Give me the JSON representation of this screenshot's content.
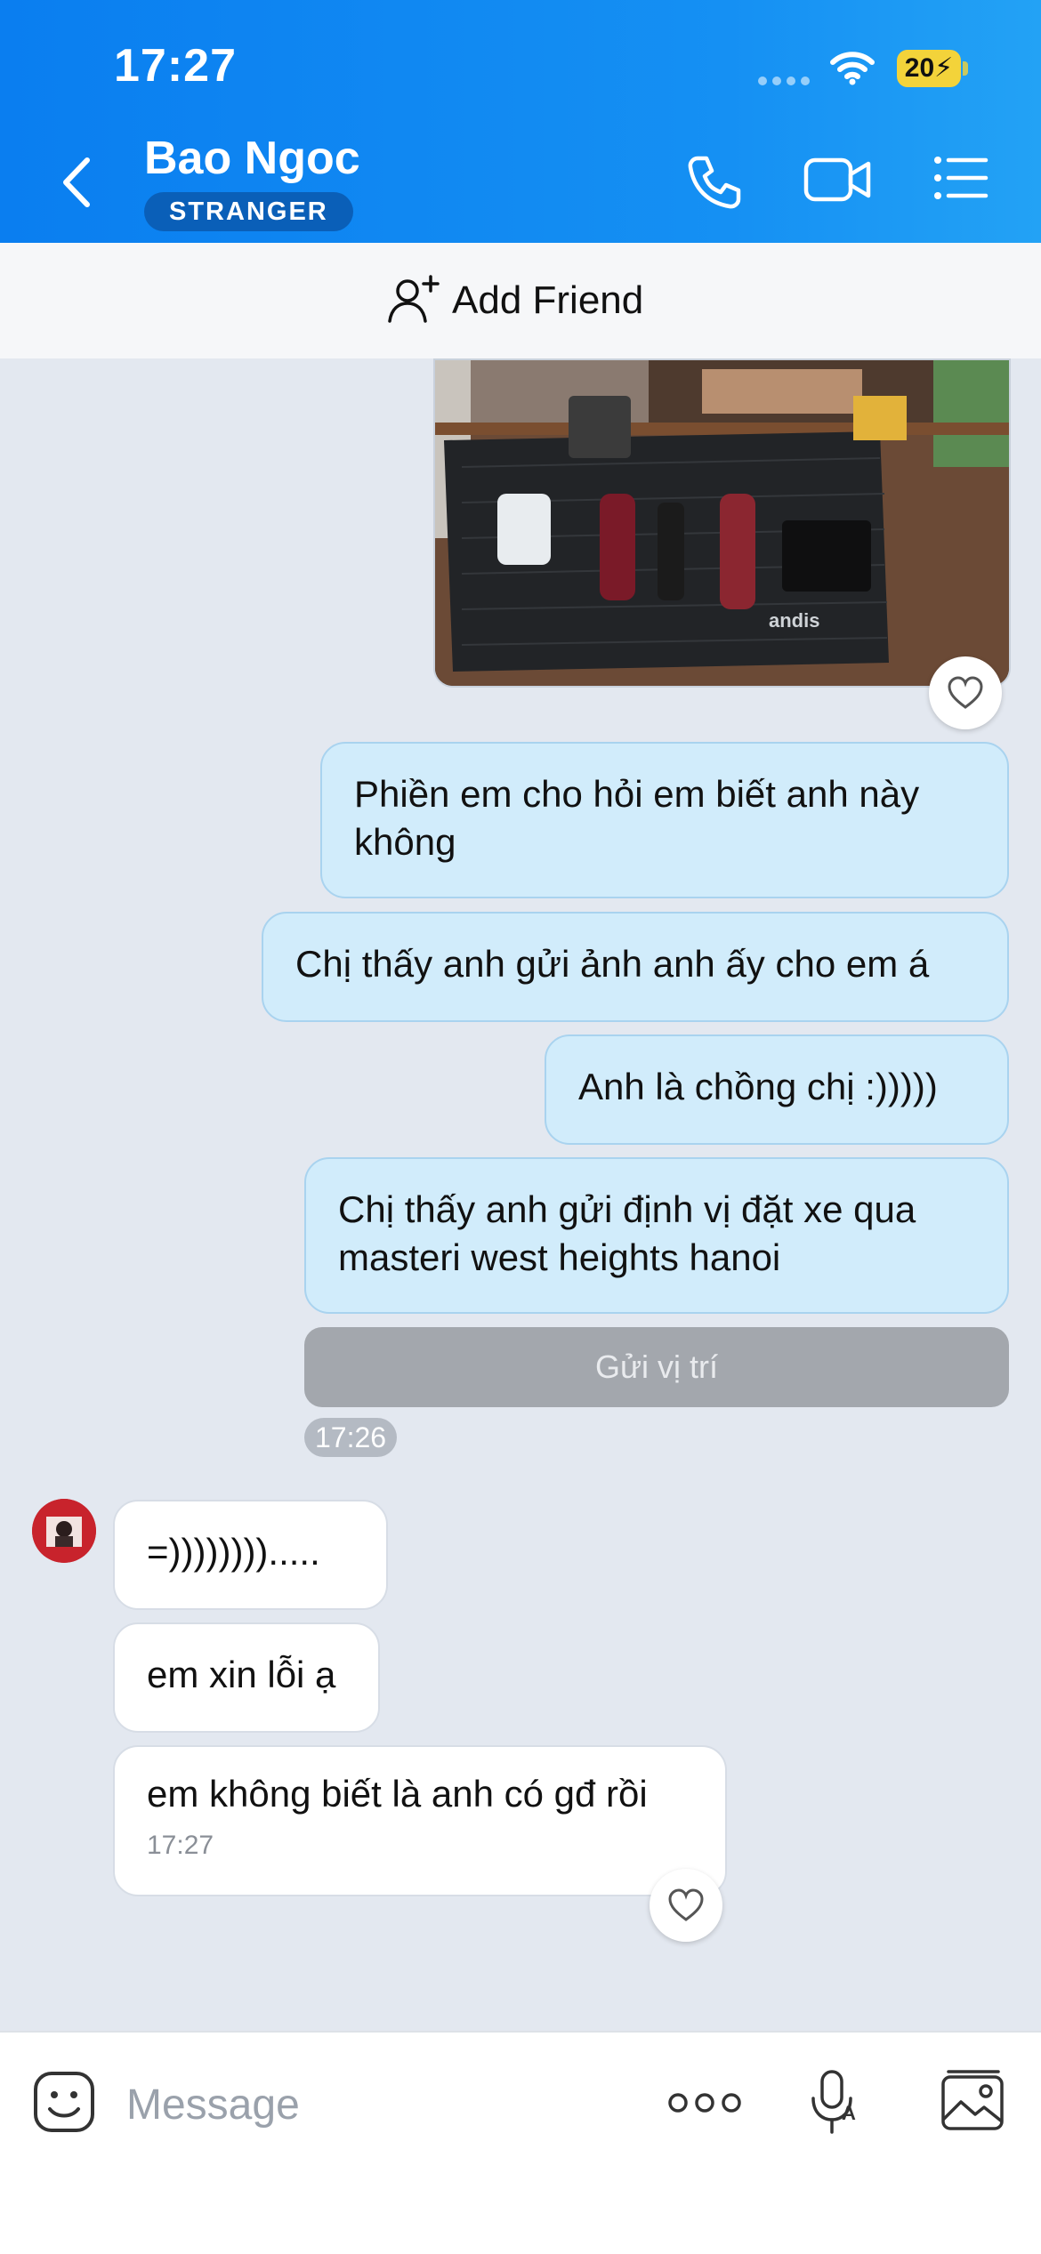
{
  "status_bar": {
    "time": "17:27",
    "battery": "20"
  },
  "header": {
    "contact_name": "Bao Ngoc",
    "badge": "STRANGER",
    "back_icon": "chevron-left-icon",
    "actions": [
      "phone-icon",
      "video-camera-icon",
      "list-menu-icon"
    ]
  },
  "add_friend": {
    "label": "Add Friend",
    "icon": "add-person-icon"
  },
  "messages": [
    {
      "direction": "outgoing",
      "type": "photo"
    },
    {
      "direction": "outgoing",
      "text": "Phiền em cho hỏi em biết anh này không"
    },
    {
      "direction": "outgoing",
      "text": "Chị thấy anh gửi ảnh anh ấy cho em á"
    },
    {
      "direction": "outgoing",
      "text": "Anh là chồng chị :)))))"
    },
    {
      "direction": "outgoing",
      "text": "Chị thấy anh gửi định vị đặt xe qua masteri west heights hanoi"
    },
    {
      "direction": "outgoing",
      "type": "location_button",
      "text": "Gửi vị trí"
    },
    {
      "direction": "incoming",
      "text": "=))))))))....."
    },
    {
      "direction": "incoming",
      "text": "em xin lỗi ạ"
    },
    {
      "direction": "incoming",
      "text": "em không biết là anh có gđ rồi",
      "time": "17:27"
    }
  ],
  "outgoing_timestamp": "17:26",
  "composer": {
    "placeholder": "Message",
    "icons": [
      "sticker-icon",
      "more-options-icon",
      "voice-text-icon",
      "image-gallery-icon"
    ]
  },
  "colors": {
    "header": "#0a7ef0",
    "chat_background": "#e3e8f0",
    "outgoing_bubble": "#d1ecfb",
    "incoming_bubble": "#ffffff",
    "location_button": "#a3a7ad",
    "badge": "#0a5fb8"
  }
}
